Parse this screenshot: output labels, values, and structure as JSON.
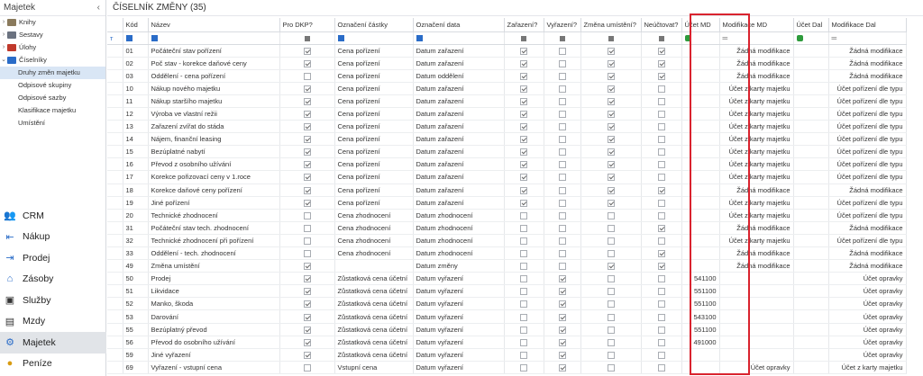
{
  "sidebar": {
    "title": "Majetek",
    "tree": [
      {
        "label": "Knihy",
        "icon": "book-icon",
        "expanded": false
      },
      {
        "label": "Sestavy",
        "icon": "report-icon",
        "expanded": false
      },
      {
        "label": "Úlohy",
        "icon": "task-icon",
        "expanded": false
      },
      {
        "label": "Číselníky",
        "icon": "gear-icon",
        "expanded": true
      }
    ],
    "subitems": [
      "Druhy změn majetku",
      "Odpisové skupiny",
      "Odpisové sazby",
      "Klasifikace majetku",
      "Umístění"
    ],
    "modules": [
      {
        "label": "CRM",
        "icon": "people-icon"
      },
      {
        "label": "Nákup",
        "icon": "purchase-icon"
      },
      {
        "label": "Prodej",
        "icon": "sale-icon"
      },
      {
        "label": "Zásoby",
        "icon": "house-icon"
      },
      {
        "label": "Služby",
        "icon": "briefcase-icon"
      },
      {
        "label": "Mzdy",
        "icon": "payroll-icon"
      },
      {
        "label": "Majetek",
        "icon": "gear-icon"
      },
      {
        "label": "Peníze",
        "icon": "money-icon"
      }
    ]
  },
  "main": {
    "title": "ČÍSELNÍK ZMĚNY (35)",
    "columns": [
      "Kód",
      "Název",
      "Pro DKP?",
      "Označení částky",
      "Označení data",
      "Zařazení?",
      "Vyřazení?",
      "Změna umístění?",
      "Neúčtovat?",
      "Účet MD",
      "Modifikace MD",
      "Účet Dal",
      "Modifikace Dal"
    ]
  },
  "rows": [
    {
      "kod": "01",
      "nazev": "Počáteční stav pořízení",
      "dkp": true,
      "castka": "Cena pořízení",
      "datum": "Datum zařazení",
      "zar": true,
      "vyr": false,
      "zmena": true,
      "neuc": true,
      "md": "",
      "modmd": "Žádná modifikace",
      "dal": "",
      "moddal": "Žádná modifikace"
    },
    {
      "kod": "02",
      "nazev": "Poč stav - korekce daňové ceny",
      "dkp": true,
      "castka": "Cena pořízení",
      "datum": "Datum zařazení",
      "zar": true,
      "vyr": false,
      "zmena": true,
      "neuc": true,
      "md": "",
      "modmd": "Žádná modifikace",
      "dal": "",
      "moddal": "Žádná modifikace"
    },
    {
      "kod": "03",
      "nazev": "Oddělení - cena pořízení",
      "dkp": false,
      "castka": "Cena pořízení",
      "datum": "Datum oddělení",
      "zar": true,
      "vyr": false,
      "zmena": true,
      "neuc": true,
      "md": "",
      "modmd": "Žádná modifikace",
      "dal": "",
      "moddal": "Žádná modifikace"
    },
    {
      "kod": "10",
      "nazev": "Nákup nového majetku",
      "dkp": true,
      "castka": "Cena pořízení",
      "datum": "Datum zařazení",
      "zar": true,
      "vyr": false,
      "zmena": true,
      "neuc": false,
      "md": "",
      "modmd": "Účet z karty majetku",
      "dal": "",
      "moddal": "Účet pořízení dle typu"
    },
    {
      "kod": "11",
      "nazev": "Nákup staršího majetku",
      "dkp": true,
      "castka": "Cena pořízení",
      "datum": "Datum zařazení",
      "zar": true,
      "vyr": false,
      "zmena": true,
      "neuc": false,
      "md": "",
      "modmd": "Účet z karty majetku",
      "dal": "",
      "moddal": "Účet pořízení dle typu"
    },
    {
      "kod": "12",
      "nazev": "Výroba ve vlastní režii",
      "dkp": true,
      "castka": "Cena pořízení",
      "datum": "Datum zařazení",
      "zar": true,
      "vyr": false,
      "zmena": true,
      "neuc": false,
      "md": "",
      "modmd": "Účet z karty majetku",
      "dal": "",
      "moddal": "Účet pořízení dle typu"
    },
    {
      "kod": "13",
      "nazev": "Zařazení zvířat do stáda",
      "dkp": true,
      "castka": "Cena pořízení",
      "datum": "Datum zařazení",
      "zar": true,
      "vyr": false,
      "zmena": true,
      "neuc": false,
      "md": "",
      "modmd": "Účet z karty majetku",
      "dal": "",
      "moddal": "Účet pořízení dle typu"
    },
    {
      "kod": "14",
      "nazev": "Nájem, finanční leasing",
      "dkp": true,
      "castka": "Cena pořízení",
      "datum": "Datum zařazení",
      "zar": true,
      "vyr": false,
      "zmena": true,
      "neuc": false,
      "md": "",
      "modmd": "Účet z karty majetku",
      "dal": "",
      "moddal": "Účet pořízení dle typu"
    },
    {
      "kod": "15",
      "nazev": "Bezúplatné nabytí",
      "dkp": true,
      "castka": "Cena pořízení",
      "datum": "Datum zařazení",
      "zar": true,
      "vyr": false,
      "zmena": true,
      "neuc": false,
      "md": "",
      "modmd": "Účet z karty majetku",
      "dal": "",
      "moddal": "Účet pořízení dle typu"
    },
    {
      "kod": "16",
      "nazev": "Převod z osobního užívání",
      "dkp": true,
      "castka": "Cena pořízení",
      "datum": "Datum zařazení",
      "zar": true,
      "vyr": false,
      "zmena": true,
      "neuc": false,
      "md": "",
      "modmd": "Účet z karty majetku",
      "dal": "",
      "moddal": "Účet pořízení dle typu"
    },
    {
      "kod": "17",
      "nazev": "Korekce pořizovací ceny v 1.roce",
      "dkp": true,
      "castka": "Cena pořízení",
      "datum": "Datum zařazení",
      "zar": true,
      "vyr": false,
      "zmena": true,
      "neuc": false,
      "md": "",
      "modmd": "Účet z karty majetku",
      "dal": "",
      "moddal": "Účet pořízení dle typu"
    },
    {
      "kod": "18",
      "nazev": "Korekce daňové ceny pořízení",
      "dkp": true,
      "castka": "Cena pořízení",
      "datum": "Datum zařazení",
      "zar": true,
      "vyr": false,
      "zmena": true,
      "neuc": true,
      "md": "",
      "modmd": "Žádná modifikace",
      "dal": "",
      "moddal": "Žádná modifikace"
    },
    {
      "kod": "19",
      "nazev": "Jiné pořízení",
      "dkp": true,
      "castka": "Cena pořízení",
      "datum": "Datum zařazení",
      "zar": true,
      "vyr": false,
      "zmena": true,
      "neuc": false,
      "md": "",
      "modmd": "Účet z karty majetku",
      "dal": "",
      "moddal": "Účet pořízení dle typu"
    },
    {
      "kod": "20",
      "nazev": "Technické zhodnocení",
      "dkp": false,
      "castka": "Cena zhodnocení",
      "datum": "Datum zhodnocení",
      "zar": false,
      "vyr": false,
      "zmena": false,
      "neuc": false,
      "md": "",
      "modmd": "Účet z karty majetku",
      "dal": "",
      "moddal": "Účet pořízení dle typu"
    },
    {
      "kod": "31",
      "nazev": "Počáteční stav tech. zhodnocení",
      "dkp": false,
      "castka": "Cena zhodnocení",
      "datum": "Datum zhodnocení",
      "zar": false,
      "vyr": false,
      "zmena": false,
      "neuc": true,
      "md": "",
      "modmd": "Žádná modifikace",
      "dal": "",
      "moddal": "Žádná modifikace"
    },
    {
      "kod": "32",
      "nazev": "Technické zhodnocení při pořízení",
      "dkp": false,
      "castka": "Cena zhodnocení",
      "datum": "Datum zhodnocení",
      "zar": false,
      "vyr": false,
      "zmena": false,
      "neuc": false,
      "md": "",
      "modmd": "Účet z karty majetku",
      "dal": "",
      "moddal": "Účet pořízení dle typu"
    },
    {
      "kod": "33",
      "nazev": "Oddělení - tech. zhodnocení",
      "dkp": false,
      "castka": "Cena zhodnocení",
      "datum": "Datum zhodnocení",
      "zar": false,
      "vyr": false,
      "zmena": false,
      "neuc": true,
      "md": "",
      "modmd": "Žádná modifikace",
      "dal": "",
      "moddal": "Žádná modifikace"
    },
    {
      "kod": "49",
      "nazev": "Změna umístění",
      "dkp": true,
      "castka": "",
      "datum": "Datum změny",
      "zar": false,
      "vyr": false,
      "zmena": true,
      "neuc": true,
      "md": "",
      "modmd": "Žádná modifikace",
      "dal": "",
      "moddal": "Žádná modifikace"
    },
    {
      "kod": "50",
      "nazev": "Prodej",
      "dkp": true,
      "castka": "Zůstatková cena účetní",
      "datum": "Datum vyřazení",
      "zar": false,
      "vyr": true,
      "zmena": false,
      "neuc": false,
      "md": "541100",
      "modmd": "",
      "dal": "",
      "moddal": "Účet opravky"
    },
    {
      "kod": "51",
      "nazev": "Likvidace",
      "dkp": true,
      "castka": "Zůstatková cena účetní",
      "datum": "Datum vyřazení",
      "zar": false,
      "vyr": true,
      "zmena": false,
      "neuc": false,
      "md": "551100",
      "modmd": "",
      "dal": "",
      "moddal": "Účet opravky"
    },
    {
      "kod": "52",
      "nazev": "Manko, škoda",
      "dkp": true,
      "castka": "Zůstatková cena účetní",
      "datum": "Datum vyřazení",
      "zar": false,
      "vyr": true,
      "zmena": false,
      "neuc": false,
      "md": "551100",
      "modmd": "",
      "dal": "",
      "moddal": "Účet opravky"
    },
    {
      "kod": "53",
      "nazev": "Darování",
      "dkp": true,
      "castka": "Zůstatková cena účetní",
      "datum": "Datum vyřazení",
      "zar": false,
      "vyr": true,
      "zmena": false,
      "neuc": false,
      "md": "543100",
      "modmd": "",
      "dal": "",
      "moddal": "Účet opravky"
    },
    {
      "kod": "55",
      "nazev": "Bezúplatný převod",
      "dkp": true,
      "castka": "Zůstatková cena účetní",
      "datum": "Datum vyřazení",
      "zar": false,
      "vyr": true,
      "zmena": false,
      "neuc": false,
      "md": "551100",
      "modmd": "",
      "dal": "",
      "moddal": "Účet opravky"
    },
    {
      "kod": "56",
      "nazev": "Převod do osobního užívání",
      "dkp": true,
      "castka": "Zůstatková cena účetní",
      "datum": "Datum vyřazení",
      "zar": false,
      "vyr": true,
      "zmena": false,
      "neuc": false,
      "md": "491000",
      "modmd": "",
      "dal": "",
      "moddal": "Účet opravky"
    },
    {
      "kod": "59",
      "nazev": "Jiné vyřazení",
      "dkp": true,
      "castka": "Zůstatková cena účetní",
      "datum": "Datum vyřazení",
      "zar": false,
      "vyr": true,
      "zmena": false,
      "neuc": false,
      "md": "",
      "modmd": "",
      "dal": "",
      "moddal": "Účet opravky"
    },
    {
      "kod": "69",
      "nazev": "Vyřazení - vstupní cena",
      "dkp": false,
      "castka": "Vstupní cena",
      "datum": "Datum vyřazení",
      "zar": false,
      "vyr": true,
      "zmena": false,
      "neuc": false,
      "md": "",
      "modmd": "Účet opravky",
      "dal": "",
      "moddal": "Účet z karty majetku"
    }
  ]
}
